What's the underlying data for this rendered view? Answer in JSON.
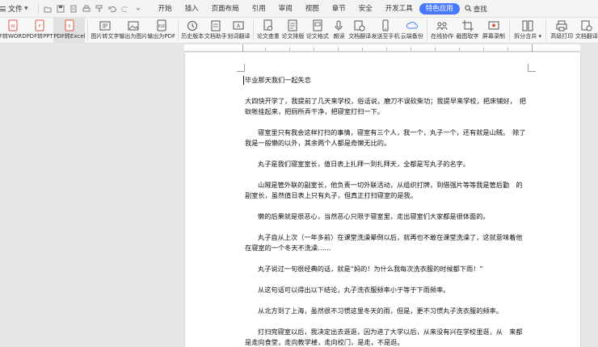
{
  "menubar": {
    "file_label": "文件",
    "tabs": [
      {
        "label": "开始",
        "active": false
      },
      {
        "label": "插入",
        "active": false
      },
      {
        "label": "页面布局",
        "active": false
      },
      {
        "label": "引用",
        "active": false
      },
      {
        "label": "审阅",
        "active": false
      },
      {
        "label": "视图",
        "active": false
      },
      {
        "label": "章节",
        "active": false
      },
      {
        "label": "安全",
        "active": false
      },
      {
        "label": "开发工具",
        "active": false
      },
      {
        "label": "特色应用",
        "active": true
      }
    ],
    "search_label": "查找",
    "accent_color": "#4778ff"
  },
  "ribbon": {
    "items": [
      {
        "label": "PDF转WORD",
        "icon": "pdf-to-word-icon"
      },
      {
        "label": "PDF转PPT",
        "icon": "pdf-to-ppt-icon"
      },
      {
        "label": "PDF转Excel",
        "icon": "pdf-to-excel-icon",
        "selected": true
      },
      {
        "label": "图片转文字",
        "icon": "image-to-text-icon"
      },
      {
        "label": "输出为图片",
        "icon": "export-image-icon"
      },
      {
        "label": "输出为PDF",
        "icon": "export-pdf-icon"
      },
      {
        "label": "历史版本",
        "icon": "history-icon"
      },
      {
        "label": "文档助手",
        "icon": "doc-assistant-icon"
      },
      {
        "label": "划词翻译",
        "icon": "translate-icon"
      },
      {
        "label": "论文查重",
        "icon": "plagiarism-check-icon"
      },
      {
        "label": "论文排版",
        "icon": "paper-format-icon"
      },
      {
        "label": "论文格式",
        "icon": "paper-style-icon"
      },
      {
        "label": "朗读",
        "icon": "read-aloud-icon"
      },
      {
        "label": "文档翻译",
        "icon": "doc-translate-icon"
      },
      {
        "label": "发送至手机",
        "icon": "send-to-phone-icon"
      },
      {
        "label": "云端备份",
        "icon": "cloud-backup-icon"
      },
      {
        "label": "在线协作",
        "icon": "collaborate-icon"
      },
      {
        "label": "截图取字",
        "icon": "screenshot-ocr-icon"
      },
      {
        "label": "屏幕录制",
        "icon": "screen-record-icon"
      },
      {
        "label": "拆分合并",
        "icon": "split-merge-icon"
      },
      {
        "label": "高级打印",
        "icon": "print-icon"
      },
      {
        "label": "文档翻译",
        "icon": "doc-translate-icon"
      }
    ]
  },
  "document": {
    "title": "毕业那天我们一起失恋",
    "paragraphs": [
      "大四快开学了，我提前了几天来学校，俗话说，磨刀不误砍柴功；我提早来学校，把床铺好，　把蚊帐挂起来，把厕所弄干净，把寝室打扫一下。",
      "寝室里只有我会这样打扫的事情，寝室有三个人，我一个，丸子一个，还有就是山贼。　除了我是一般懒的以外，其余两个人都是奇懒无比的。",
      "丸子是我们寝室室长，值日表上扎拜一到扎拜天，全都是写丸子的名字。",
      "山贼是管外联的副室长，他负责一切外联活动，从组织打牌，到借强片等等我是管后勤　的副室长，虽然值日表上只有丸子，但真正打扫寝室的是我。",
      "懒的后果就是很恶心，当然恶心只限于寝室里，走出寝室们大家都是很体面的。",
      "丸子自从上次（一年多前）在课堂洗澡晕倒以后，就再也不敢在课堂洗澡了，这就意味着他在寝室的一个冬天不洗澡……",
      "丸子说过一句很经典的话，就是“妈的！为什么我每次洗衣服的时候都下雨！”",
      "从这句话可以得出以下结论，丸子洗衣服频率小于等于下雨频率。",
      "从北方到了上海，虽然很不习惯这里冬天的雨，但是，更不习惯丸子洗衣服的频率。",
      "打扫完寝室以后，我决定出去逛逛，因为进了大学以后，从来没有兴在学校里逛，从　来都是走向食堂，走向教学楼，走向校门，是走，不是逛。"
    ]
  }
}
